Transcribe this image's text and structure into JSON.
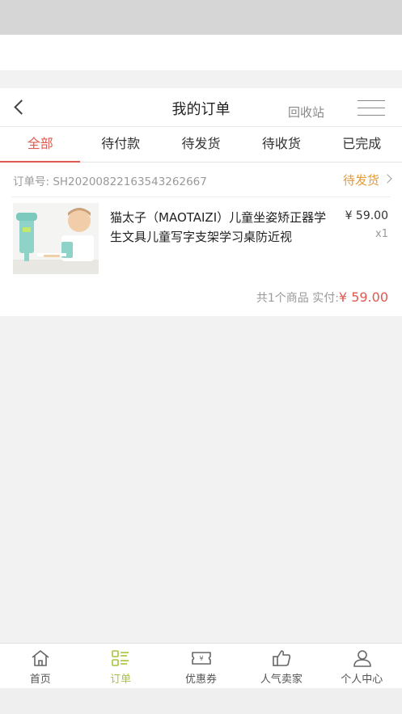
{
  "header": {
    "title": "我的订单",
    "recycle_label": "回收站"
  },
  "tabs": [
    {
      "label": "全部",
      "active": true
    },
    {
      "label": "待付款",
      "active": false
    },
    {
      "label": "待发货",
      "active": false
    },
    {
      "label": "待收货",
      "active": false
    },
    {
      "label": "已完成",
      "active": false
    }
  ],
  "order": {
    "order_no": "订单号: SH20200822163543262667",
    "status": "待发货",
    "product_name": "猫太子（MAOTAIZI）儿童坐姿矫正器学生文具儿童写字支架学习桌防近视",
    "price": "¥ 59.00",
    "quantity": "x1",
    "summary_prefix": "共1个商品  实付:",
    "summary_amount": "¥ 59.00"
  },
  "bottom_nav": [
    {
      "label": "首页",
      "icon": "home-icon",
      "active": false
    },
    {
      "label": "订单",
      "icon": "order-list-icon",
      "active": true
    },
    {
      "label": "优惠券",
      "icon": "coupon-icon",
      "active": false
    },
    {
      "label": "人气卖家",
      "icon": "thumbs-up-icon",
      "active": false
    },
    {
      "label": "个人中心",
      "icon": "user-icon",
      "active": false
    }
  ],
  "colors": {
    "accent_red": "#e05a4f",
    "status_orange": "#e49a34",
    "nav_active_green": "#a7c53b"
  }
}
